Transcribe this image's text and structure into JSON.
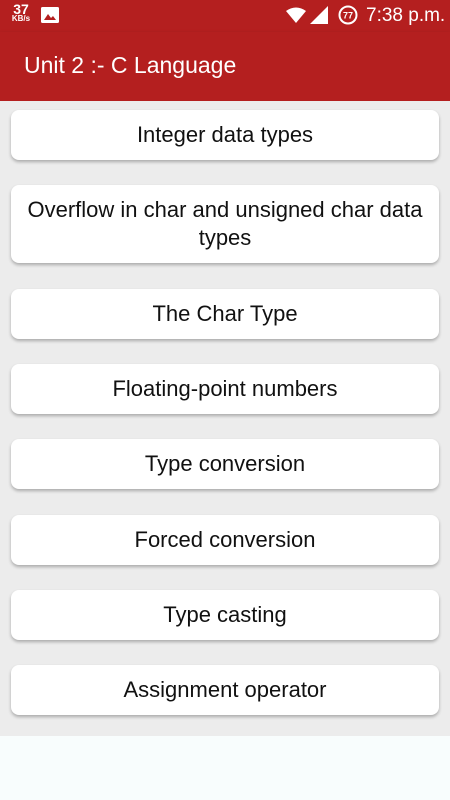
{
  "status_bar": {
    "net_speed_value": "37",
    "net_speed_unit": "KB/s",
    "battery_level": "77",
    "time": "7:38 p.m."
  },
  "app_bar": {
    "title": "Unit 2 :- C Language"
  },
  "topics": [
    {
      "label": "Integer data types"
    },
    {
      "label": "Overflow in char and unsigned char data types"
    },
    {
      "label": "The Char Type"
    },
    {
      "label": "Floating-point numbers"
    },
    {
      "label": "Type conversion"
    },
    {
      "label": "Forced conversion"
    },
    {
      "label": "Type casting"
    },
    {
      "label": "Assignment operator"
    }
  ],
  "colors": {
    "primary": "#b41f1f",
    "list_background": "#ececec",
    "card": "#ffffff"
  }
}
